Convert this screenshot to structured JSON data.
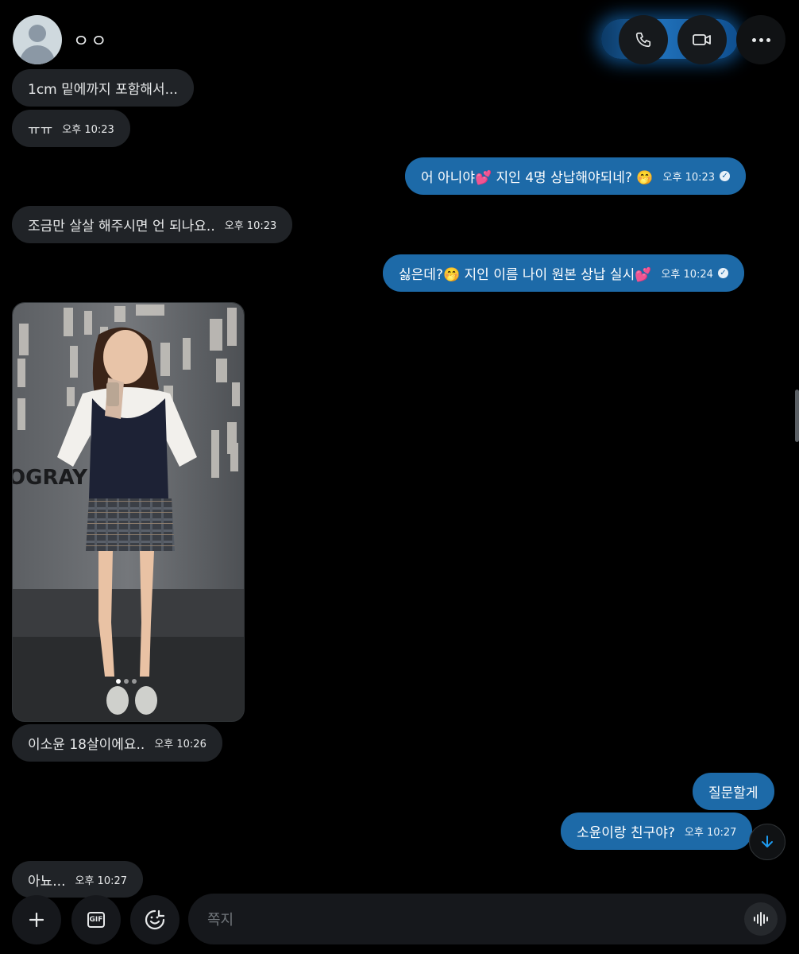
{
  "header": {
    "user_name": "ㅇㅇ"
  },
  "messages": [
    {
      "id": "m1",
      "dir": "in",
      "text": "1cm 밑에까지 포함해서...",
      "time": ""
    },
    {
      "id": "m2",
      "dir": "in",
      "text": "ㅠㅠ",
      "time": "오후 10:23"
    },
    {
      "id": "m3",
      "dir": "out",
      "text": "어 아니야💕 지인 4명 상납해야되네? 🤭",
      "time": "오후 10:23"
    },
    {
      "id": "m4",
      "dir": "in",
      "text": "조금만 살살 해주시면 언 되나요..",
      "time": "오후 10:23"
    },
    {
      "id": "m5",
      "dir": "out",
      "text": "싫은데?🤭 지인 이름 나이 원본 상납 실시💕",
      "time": "오후 10:24"
    },
    {
      "id": "m6",
      "dir": "in",
      "text": "이소윤 18살이에요..",
      "time": "오후 10:26"
    },
    {
      "id": "m7",
      "dir": "out",
      "text": "질문할게",
      "time": ""
    },
    {
      "id": "m8",
      "dir": "out",
      "text": "소윤이랑 친구야?",
      "time": "오후 10:27"
    },
    {
      "id": "m9",
      "dir": "in",
      "text": "아뇨...",
      "time": "오후 10:27"
    }
  ],
  "photo": {
    "wall_text": "OGRAY"
  },
  "composer": {
    "placeholder": "쪽지",
    "gif_label": "GIF"
  },
  "colors": {
    "background": "#000000",
    "incoming_bubble": "#202327",
    "outgoing_bubble": "#1d6aa8",
    "accent": "#1d9bf0"
  }
}
